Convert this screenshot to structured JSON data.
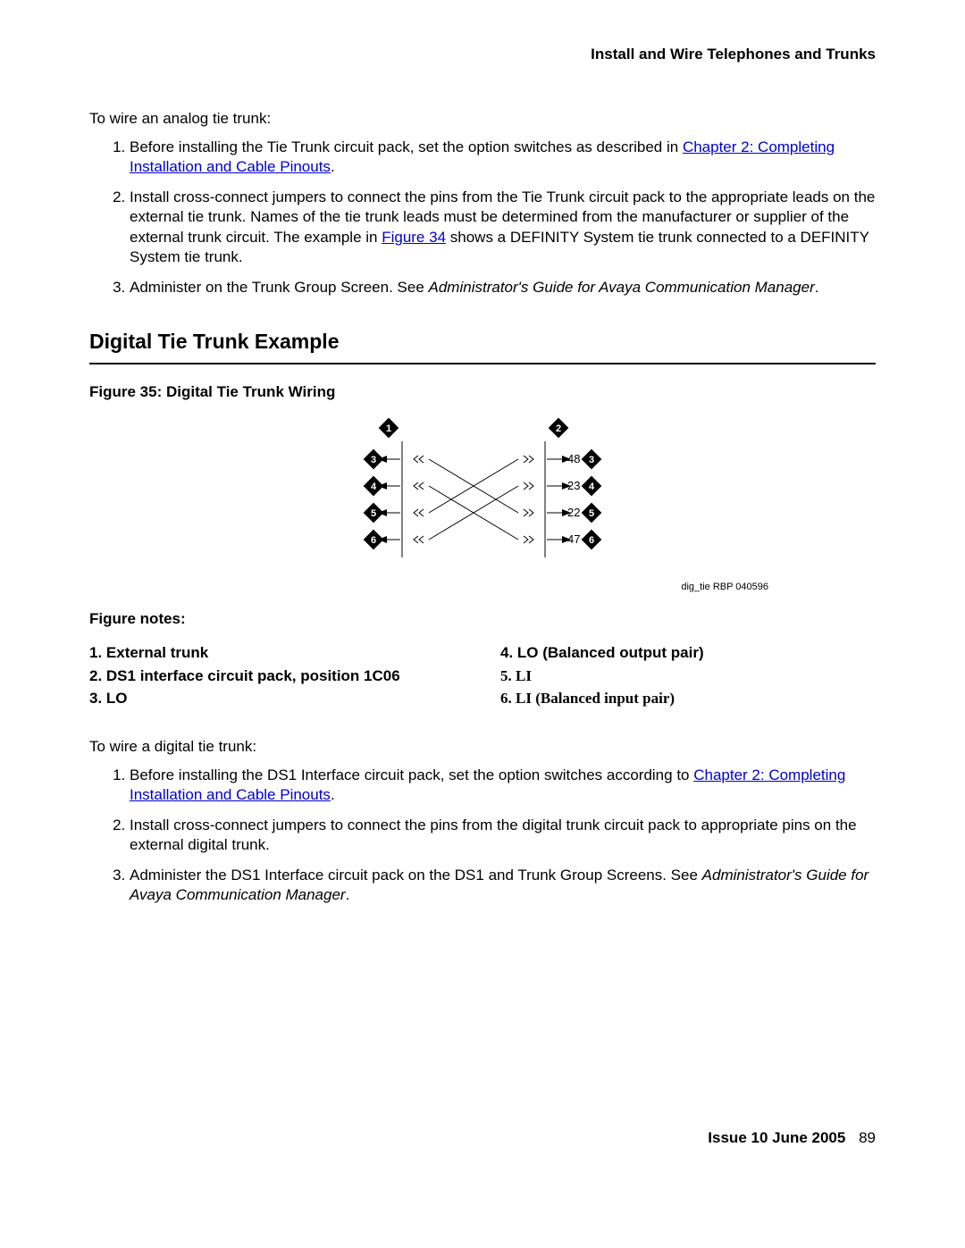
{
  "header": "Install and Wire Telephones and Trunks",
  "section1": {
    "intro": "To wire an analog tie trunk:",
    "item1_a": "Before installing the Tie Trunk circuit pack, set the option switches as described in ",
    "item1_link": "Chapter 2: Completing Installation and Cable Pinouts",
    "item1_b": ".",
    "item2_a": "Install cross-connect jumpers to connect the pins from the Tie Trunk circuit pack to the appropriate leads on the external tie trunk. Names of the tie trunk leads must be determined from the manufacturer or supplier of the external trunk circuit. The example in ",
    "item2_link": "Figure 34",
    "item2_b": " shows a DEFINITY System tie trunk connected to a DEFINITY System tie trunk.",
    "item3_a": "Administer on the Trunk Group Screen. See ",
    "item3_i": "Administrator's Guide for Avaya Communication Manager",
    "item3_b": "."
  },
  "heading2": "Digital Tie Trunk Example",
  "figure": {
    "caption": "Figure 35: Digital Tie Trunk Wiring",
    "credit": "dig_tie RBP 040596",
    "labels": {
      "top_left": "1",
      "top_right": "2",
      "l1": "3",
      "l2": "4",
      "l3": "5",
      "l4": "6",
      "r1": "3",
      "r2": "4",
      "r3": "5",
      "r4": "6",
      "p1": "48",
      "p2": "23",
      "p3": "22",
      "p4": "47"
    }
  },
  "notes": {
    "heading": "Figure notes:",
    "left": {
      "n1": "1.  External trunk",
      "n2": "2.  DS1 interface circuit pack, position 1C06",
      "n3": "3.  LO"
    },
    "right": {
      "n4": "4.  LO (Balanced output pair)",
      "n5": "5.  LI",
      "n6": "6.  LI (Balanced input pair)"
    }
  },
  "section2": {
    "intro": "To wire a digital tie trunk:",
    "item1_a": "Before installing the DS1 Interface circuit pack, set the option switches according to ",
    "item1_link": "Chapter 2: Completing Installation and Cable Pinouts",
    "item1_b": ".",
    "item2": "Install cross-connect jumpers to connect the pins from the digital trunk circuit pack to appropriate pins on the external digital trunk.",
    "item3_a": "Administer the DS1 Interface circuit pack on the DS1 and Trunk Group Screens. See ",
    "item3_i": "Administrator's Guide for Avaya Communication Manager",
    "item3_b": "."
  },
  "footer": {
    "issue": "Issue 10    June 2005",
    "page": "89"
  }
}
